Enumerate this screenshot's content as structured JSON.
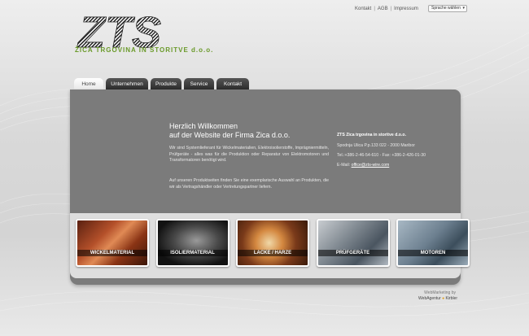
{
  "logo": {
    "mark": "ZTS",
    "subtitle": "ŽICA TRGOVINA IN STORITVE d.o.o."
  },
  "top_links": [
    "Kontakt",
    "AGB",
    "Impressum"
  ],
  "language_select": {
    "value": "Sprache wählen"
  },
  "nav": {
    "tabs": [
      {
        "label": "Home",
        "active": true
      },
      {
        "label": "Unternehmen",
        "active": false
      },
      {
        "label": "Produkte",
        "active": false
      },
      {
        "label": "Service",
        "active": false
      },
      {
        "label": "Kontakt",
        "active": false
      }
    ]
  },
  "welcome": {
    "title_line1": "Herzlich Willkommen",
    "title_line2": "auf der Website der Firma Zica d.o.o.",
    "paragraph1": "Wir sind Systemlieferant für Wickelmaterialien, Elektroisolierstoffe, Imprägniermitteln, Prüfgeräte - alles was für die Produktion oder Reparatur von Elektromotoren und Transformatoren benötigt wird.",
    "paragraph2": "Auf unseren Produktseiten finden Sie eine exemplarische Auswahl an Produkten, die wir als Vertragshändler oder Vertretungspartner liefern."
  },
  "contact": {
    "company": "ZTS Zica trgovina in storitve d.o.o.",
    "address": "Spodnja Ulica P.p.133 022 - 2000 Maribor",
    "phone_fax": "Tel.:+386-2-46-54-610 - Fax: +386-2-426-01-30",
    "email_label": "E-Mail:",
    "email": "office@zts-wire.com"
  },
  "products": [
    {
      "label": "WICKELMATERIAL"
    },
    {
      "label": "ISOLIERMATERIAL"
    },
    {
      "label": "LACKE / HARZE"
    },
    {
      "label": "PRÜFGERÄTE"
    },
    {
      "label": "MOTOREN"
    }
  ],
  "footer": {
    "line1": "WebMarketing by",
    "agency_a": "WebAgentur",
    "agency_b": "Kirbler"
  },
  "colors": {
    "panel": "#7b7b7b",
    "logo_green": "#6a9a2a",
    "tab_dark": "#2a2a2a"
  }
}
